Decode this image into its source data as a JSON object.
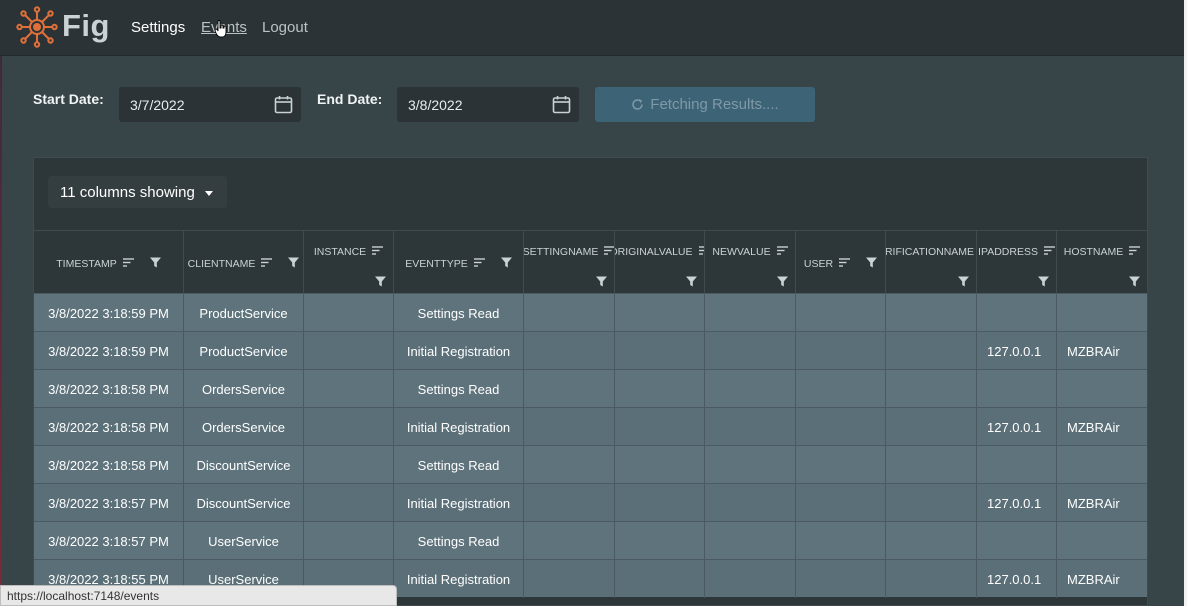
{
  "app": {
    "brand": "Fig",
    "nav": {
      "settings": "Settings",
      "events": "Events",
      "logout": "Logout"
    }
  },
  "filters": {
    "start_label": "Start Date:",
    "start_value": "3/7/2022",
    "end_label": "End Date:",
    "end_value": "3/8/2022",
    "fetch_label": "Fetching Results...."
  },
  "grid": {
    "columns_toggle": "11 columns showing",
    "columns": [
      "TIMESTAMP",
      "CLIENTNAME",
      "INSTANCE",
      "EVENTTYPE",
      "SETTINGNAME",
      "ORIGINALVALUE",
      "NEWVALUE",
      "USER",
      "VERIFICATIONNAME",
      "IPADDRESS",
      "HOSTNAME"
    ],
    "rows": [
      [
        "3/8/2022 3:18:59 PM",
        "ProductService",
        "",
        "Settings Read",
        "",
        "",
        "",
        "",
        "",
        "",
        ""
      ],
      [
        "3/8/2022 3:18:59 PM",
        "ProductService",
        "",
        "Initial Registration",
        "",
        "",
        "",
        "",
        "",
        "127.0.0.1",
        "MZBRAir"
      ],
      [
        "3/8/2022 3:18:58 PM",
        "OrdersService",
        "",
        "Settings Read",
        "",
        "",
        "",
        "",
        "",
        "",
        ""
      ],
      [
        "3/8/2022 3:18:58 PM",
        "OrdersService",
        "",
        "Initial Registration",
        "",
        "",
        "",
        "",
        "",
        "127.0.0.1",
        "MZBRAir"
      ],
      [
        "3/8/2022 3:18:58 PM",
        "DiscountService",
        "",
        "Settings Read",
        "",
        "",
        "",
        "",
        "",
        "",
        ""
      ],
      [
        "3/8/2022 3:18:57 PM",
        "DiscountService",
        "",
        "Initial Registration",
        "",
        "",
        "",
        "",
        "",
        "127.0.0.1",
        "MZBRAir"
      ],
      [
        "3/8/2022 3:18:57 PM",
        "UserService",
        "",
        "Settings Read",
        "",
        "",
        "",
        "",
        "",
        "",
        ""
      ],
      [
        "3/8/2022 3:18:55 PM",
        "UserService",
        "",
        "Initial Registration",
        "",
        "",
        "",
        "",
        "",
        "127.0.0.1",
        "MZBRAir"
      ]
    ]
  },
  "status_url": "https://localhost:7148/events"
}
